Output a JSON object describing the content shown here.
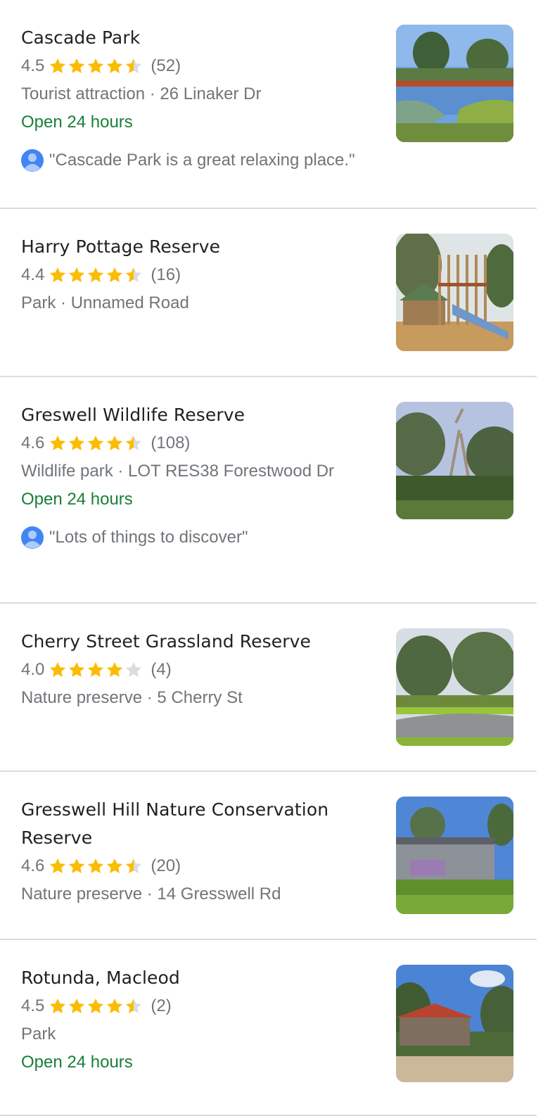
{
  "places": [
    {
      "name": "Cascade Park",
      "rating": "4.5",
      "rating_value": 4.5,
      "reviews_count": "(52)",
      "category": "Tourist attraction",
      "address": "26 Linaker Dr",
      "hours": "Open 24 hours",
      "review_snippet": "\"Cascade Park is a great relaxing place.\"",
      "photo": "pond-photo"
    },
    {
      "name": "Harry Pottage Reserve",
      "rating": "4.4",
      "rating_value": 4.4,
      "reviews_count": "(16)",
      "category": "Park",
      "address": "Unnamed Road",
      "hours": "",
      "review_snippet": "",
      "photo": "playground-photo"
    },
    {
      "name": "Greswell Wildlife Reserve",
      "rating": "4.6",
      "rating_value": 4.6,
      "reviews_count": "(108)",
      "category": "Wildlife park",
      "address": "LOT RES38 Forestwood Dr",
      "hours": "Open 24 hours",
      "review_snippet": "\"Lots of things to discover\"",
      "photo": "woodland-photo"
    },
    {
      "name": "Cherry Street Grassland Reserve",
      "rating": "4.0",
      "rating_value": 4.0,
      "reviews_count": "(4)",
      "category": "Nature preserve",
      "address": "5 Cherry St",
      "hours": "",
      "review_snippet": "",
      "photo": "path-photo"
    },
    {
      "name": "Gresswell Hill Nature Conservation Reserve",
      "rating": "4.6",
      "rating_value": 4.6,
      "reviews_count": "(20)",
      "category": "Nature preserve",
      "address": "14 Gresswell Rd",
      "hours": "",
      "review_snippet": "",
      "photo": "tank-photo"
    },
    {
      "name": "Rotunda, Macleod",
      "rating": "4.5",
      "rating_value": 4.5,
      "reviews_count": "(2)",
      "category": "Park",
      "address": "",
      "hours": "Open 24 hours",
      "review_snippet": "",
      "photo": "rotunda-photo"
    }
  ],
  "colors": {
    "star_filled": "#fbbc04",
    "star_empty": "#dadce0",
    "open_text": "#188038",
    "name_text": "#202124",
    "secondary_text": "#70757a",
    "divider": "#dadce0",
    "avatar": "#4285f4"
  }
}
